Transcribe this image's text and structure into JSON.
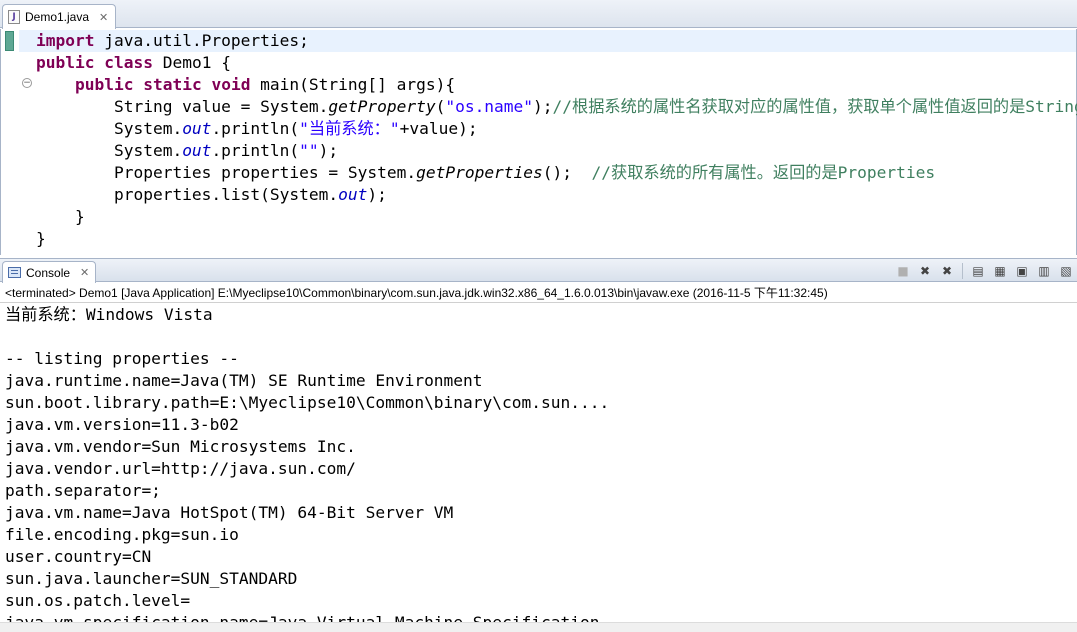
{
  "editor": {
    "tab_label": "Demo1.java",
    "lines": [
      [
        {
          "t": "import",
          "c": "kw"
        },
        {
          "t": " java.util.Properties;",
          "c": ""
        }
      ],
      [
        {
          "t": "public",
          "c": "kw"
        },
        {
          "t": " ",
          "c": ""
        },
        {
          "t": "class",
          "c": "kw"
        },
        {
          "t": " Demo1 {",
          "c": ""
        }
      ],
      [
        {
          "t": "    ",
          "c": ""
        },
        {
          "t": "public",
          "c": "kw"
        },
        {
          "t": " ",
          "c": ""
        },
        {
          "t": "static",
          "c": "kw"
        },
        {
          "t": " ",
          "c": ""
        },
        {
          "t": "void",
          "c": "kw"
        },
        {
          "t": " main(String[] args){",
          "c": ""
        }
      ],
      [
        {
          "t": "        String value = System.",
          "c": ""
        },
        {
          "t": "getProperty",
          "c": "smeth"
        },
        {
          "t": "(",
          "c": ""
        },
        {
          "t": "\"os.name\"",
          "c": "str"
        },
        {
          "t": ");",
          "c": ""
        },
        {
          "t": "//根据系统的属性名获取对应的属性值，获取单个属性值返回的是String",
          "c": "cmt"
        }
      ],
      [
        {
          "t": "        System.",
          "c": ""
        },
        {
          "t": "out",
          "c": "fld"
        },
        {
          "t": ".println(",
          "c": ""
        },
        {
          "t": "\"当前系统：\"",
          "c": "str"
        },
        {
          "t": "+value);",
          "c": ""
        }
      ],
      [
        {
          "t": "        System.",
          "c": ""
        },
        {
          "t": "out",
          "c": "fld"
        },
        {
          "t": ".println(",
          "c": ""
        },
        {
          "t": "\"\"",
          "c": "str"
        },
        {
          "t": ");",
          "c": ""
        }
      ],
      [
        {
          "t": "        Properties properties = System.",
          "c": ""
        },
        {
          "t": "getProperties",
          "c": "smeth"
        },
        {
          "t": "();  ",
          "c": ""
        },
        {
          "t": "//获取系统的所有属性。返回的是Properties",
          "c": "cmt"
        }
      ],
      [
        {
          "t": "        properties.list(System.",
          "c": ""
        },
        {
          "t": "out",
          "c": "fld"
        },
        {
          "t": ");",
          "c": ""
        }
      ],
      [
        {
          "t": "    }",
          "c": ""
        }
      ],
      [
        {
          "t": "}",
          "c": ""
        }
      ]
    ]
  },
  "console": {
    "tab_label": "Console",
    "status": "<terminated> Demo1 [Java Application] E:\\Myeclipse10\\Common\\binary\\com.sun.java.jdk.win32.x86_64_1.6.0.013\\bin\\javaw.exe (2016-11-5 下午11:32:45)",
    "toolbar_icons": [
      "terminate-icon",
      "remove-launch-icon",
      "remove-all-terminated-icon",
      "clear-console-icon",
      "scroll-lock-icon",
      "pin-console-icon",
      "display-selected-console-icon",
      "open-console-icon"
    ],
    "output": [
      "当前系统：Windows Vista",
      "",
      "-- listing properties --",
      "java.runtime.name=Java(TM) SE Runtime Environment",
      "sun.boot.library.path=E:\\Myeclipse10\\Common\\binary\\com.sun....",
      "java.vm.version=11.3-b02",
      "java.vm.vendor=Sun Microsystems Inc.",
      "java.vendor.url=http://java.sun.com/",
      "path.separator=;",
      "java.vm.name=Java HotSpot(TM) 64-Bit Server VM",
      "file.encoding.pkg=sun.io",
      "user.country=CN",
      "sun.java.launcher=SUN_STANDARD",
      "sun.os.patch.level=",
      "java.vm.specification.name=Java Virtual Machine Specification"
    ]
  }
}
